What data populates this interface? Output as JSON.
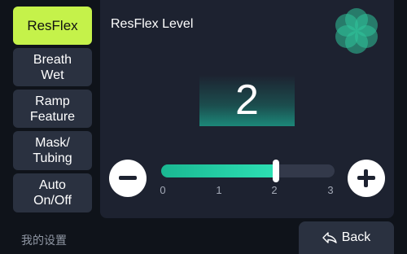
{
  "sidebar": {
    "items": [
      {
        "label": "ResFlex",
        "active": true
      },
      {
        "label": "Breath\nWet",
        "active": false
      },
      {
        "label": "Ramp\nFeature",
        "active": false
      },
      {
        "label": "Mask/\nTubing",
        "active": false
      },
      {
        "label": "Auto\nOn/Off",
        "active": false
      }
    ]
  },
  "panel": {
    "title": "ResFlex Level",
    "value": "2",
    "logo_icon": "flower-logo-icon"
  },
  "slider": {
    "min": 0,
    "max": 3,
    "value": 2,
    "ticks": [
      "0",
      "1",
      "2",
      "3"
    ],
    "decrease_icon": "minus-icon",
    "increase_icon": "plus-icon"
  },
  "footer": {
    "label": "我的设置",
    "back_label": "Back",
    "back_icon": "back-arrow-icon"
  },
  "colors": {
    "active": "#c5f24a",
    "accent": "#1ab892",
    "panel": "#1d2230",
    "button": "#2a3140"
  }
}
